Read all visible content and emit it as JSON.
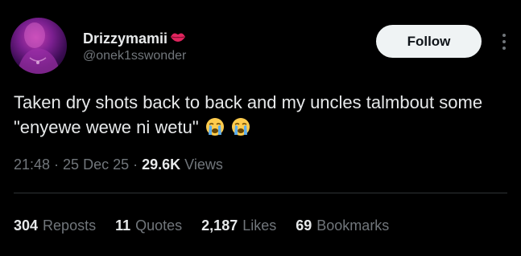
{
  "author": {
    "display_name": "Drizzymamii",
    "name_emoji": "lips-icon",
    "handle": "@onek1sswonder"
  },
  "actions": {
    "follow_label": "Follow",
    "more_icon": "more-vertical-icon"
  },
  "tweet": {
    "text": "Taken dry shots back to back and my uncles talmbout some \"enyewe wewe ni wetu\"",
    "emojis": [
      "loudly-crying-face-icon",
      "loudly-crying-face-icon"
    ]
  },
  "meta": {
    "time": "21:48",
    "date": "25 Dec 25",
    "views_count": "29.6K",
    "views_label": "Views",
    "separator": "·"
  },
  "stats": [
    {
      "count": "304",
      "label": "Reposts"
    },
    {
      "count": "11",
      "label": "Quotes"
    },
    {
      "count": "2,187",
      "label": "Likes"
    },
    {
      "count": "69",
      "label": "Bookmarks"
    }
  ],
  "colors": {
    "background": "#000000",
    "primary_text": "#e7e9ea",
    "secondary_text": "#71767b",
    "divider": "#2f3336",
    "follow_bg": "#eff3f4",
    "follow_text": "#0f1419",
    "lips": "#e0245e"
  }
}
